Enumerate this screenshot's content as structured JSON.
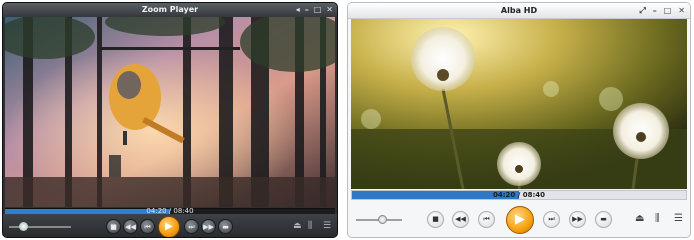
{
  "players": [
    {
      "title": "Zoom Player",
      "time_display": "04:20 / 08:40",
      "progress": 0.5,
      "volume_level": 0.2,
      "accent_color": "#2f7fd0",
      "play_color": "#f29a0a"
    },
    {
      "title": "Alba HD",
      "time_display": "04:20 / 08:40",
      "progress": 0.5,
      "volume_level": 0.5,
      "accent_color": "#2e78c9",
      "play_color": "#f4a20d"
    }
  ],
  "icons": {
    "minimize": "minimize-icon",
    "maximize": "maximize-icon",
    "close": "close-icon",
    "fullscreen": "fullscreen-icon",
    "stop": "stop-icon",
    "rewind": "rewind-icon",
    "previous": "previous-icon",
    "play": "play-icon",
    "next": "next-icon",
    "fast_forward": "fast-forward-icon",
    "open": "open-folder-icon",
    "eject": "eject-icon",
    "equalizer": "equalizer-icon",
    "playlist": "playlist-icon"
  }
}
